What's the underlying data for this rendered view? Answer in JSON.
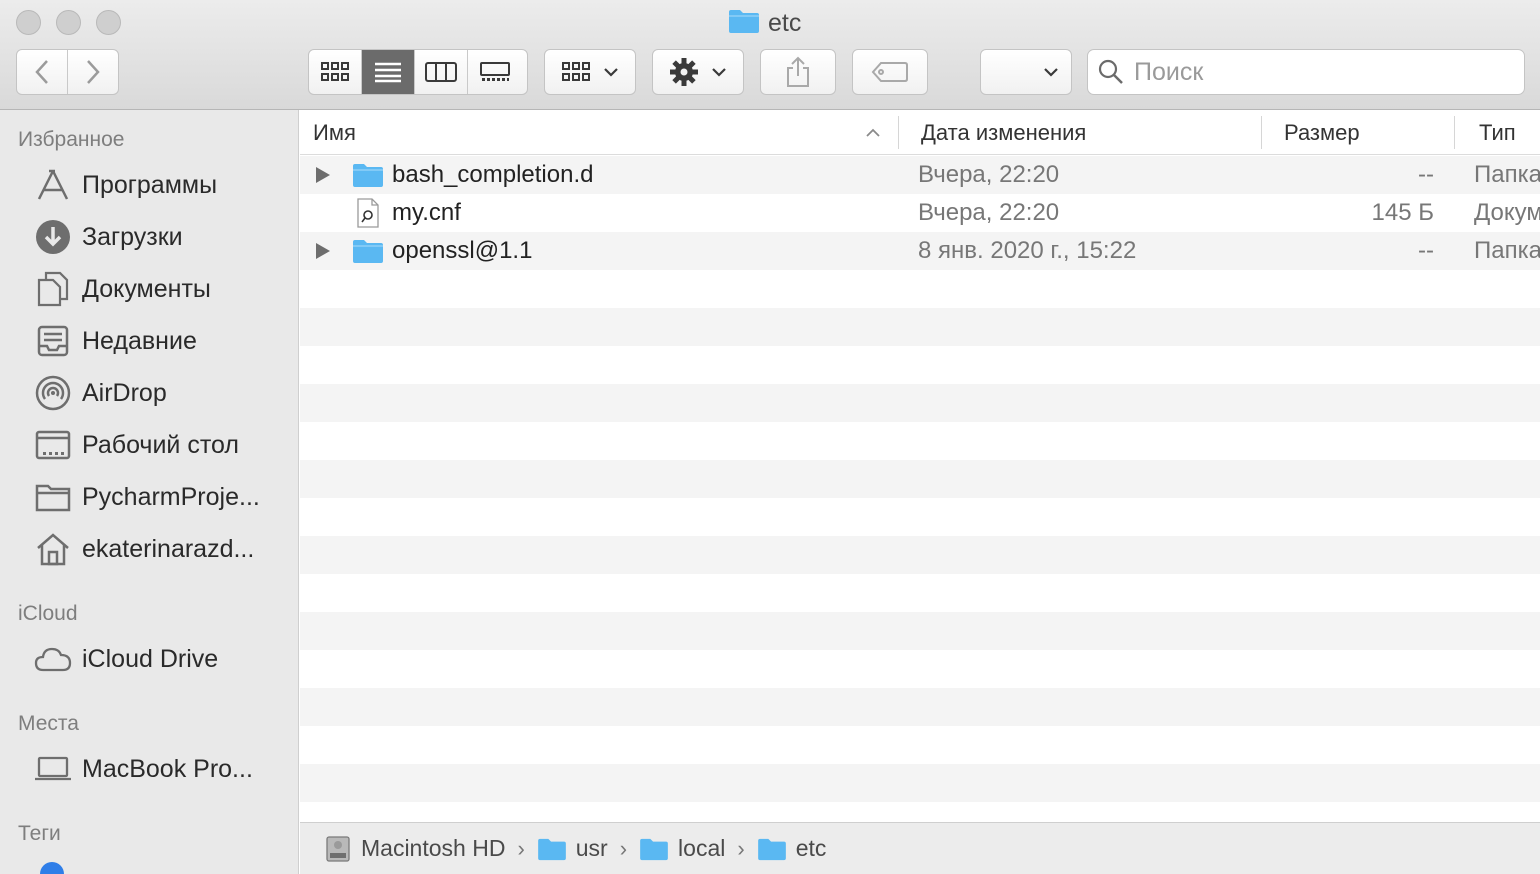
{
  "window": {
    "title": "etc",
    "folder_icon": "folder-icon"
  },
  "toolbar": {
    "back": "chevron-left-icon",
    "forward": "chevron-right-icon",
    "view_modes": [
      "icons",
      "list",
      "columns",
      "gallery"
    ],
    "active_view": "list",
    "group_menu": "grid-dropdown-icon",
    "action_menu": "gear-icon",
    "share": "share-icon",
    "tags": "tag-icon",
    "search_placeholder": "Поиск"
  },
  "sidebar": {
    "favorites_heading": "Избранное",
    "favorites": [
      {
        "label": "Программы",
        "icon": "applications-icon"
      },
      {
        "label": "Загрузки",
        "icon": "downloads-icon"
      },
      {
        "label": "Документы",
        "icon": "documents-icon"
      },
      {
        "label": "Недавние",
        "icon": "recents-icon"
      },
      {
        "label": "AirDrop",
        "icon": "airdrop-icon"
      },
      {
        "label": "Рабочий стол",
        "icon": "desktop-icon"
      },
      {
        "label": "PycharmProje...",
        "icon": "folder-icon"
      },
      {
        "label": "ekaterinarazd...",
        "icon": "home-icon"
      }
    ],
    "icloud_heading": "iCloud",
    "icloud": [
      {
        "label": "iCloud Drive",
        "icon": "cloud-icon"
      }
    ],
    "places_heading": "Места",
    "places": [
      {
        "label": "MacBook Pro...",
        "icon": "laptop-icon"
      }
    ],
    "tags_heading": "Теги",
    "tag_color": "#2f7ee8"
  },
  "columns": {
    "name": "Имя",
    "date": "Дата изменения",
    "size": "Размер",
    "kind": "Тип"
  },
  "files": [
    {
      "name": "bash_completion.d",
      "date": "Вчера, 22:20",
      "size": "--",
      "kind": "Папка",
      "type": "folder"
    },
    {
      "name": "my.cnf",
      "date": "Вчера, 22:20",
      "size": "145 Б",
      "kind": "Докум",
      "type": "document"
    },
    {
      "name": "openssl@1.1",
      "date": "8 янв. 2020 г., 15:22",
      "size": "--",
      "kind": "Папка",
      "type": "folder"
    }
  ],
  "pathbar": [
    {
      "label": "Macintosh HD",
      "icon": "hard-drive-icon"
    },
    {
      "label": "usr",
      "icon": "folder-icon"
    },
    {
      "label": "local",
      "icon": "folder-icon"
    },
    {
      "label": "etc",
      "icon": "folder-icon"
    }
  ],
  "colors": {
    "folder_blue": "#5ab8f2",
    "active_segment": "#6b6b6b",
    "sidebar_bg": "#e9e9e9"
  }
}
